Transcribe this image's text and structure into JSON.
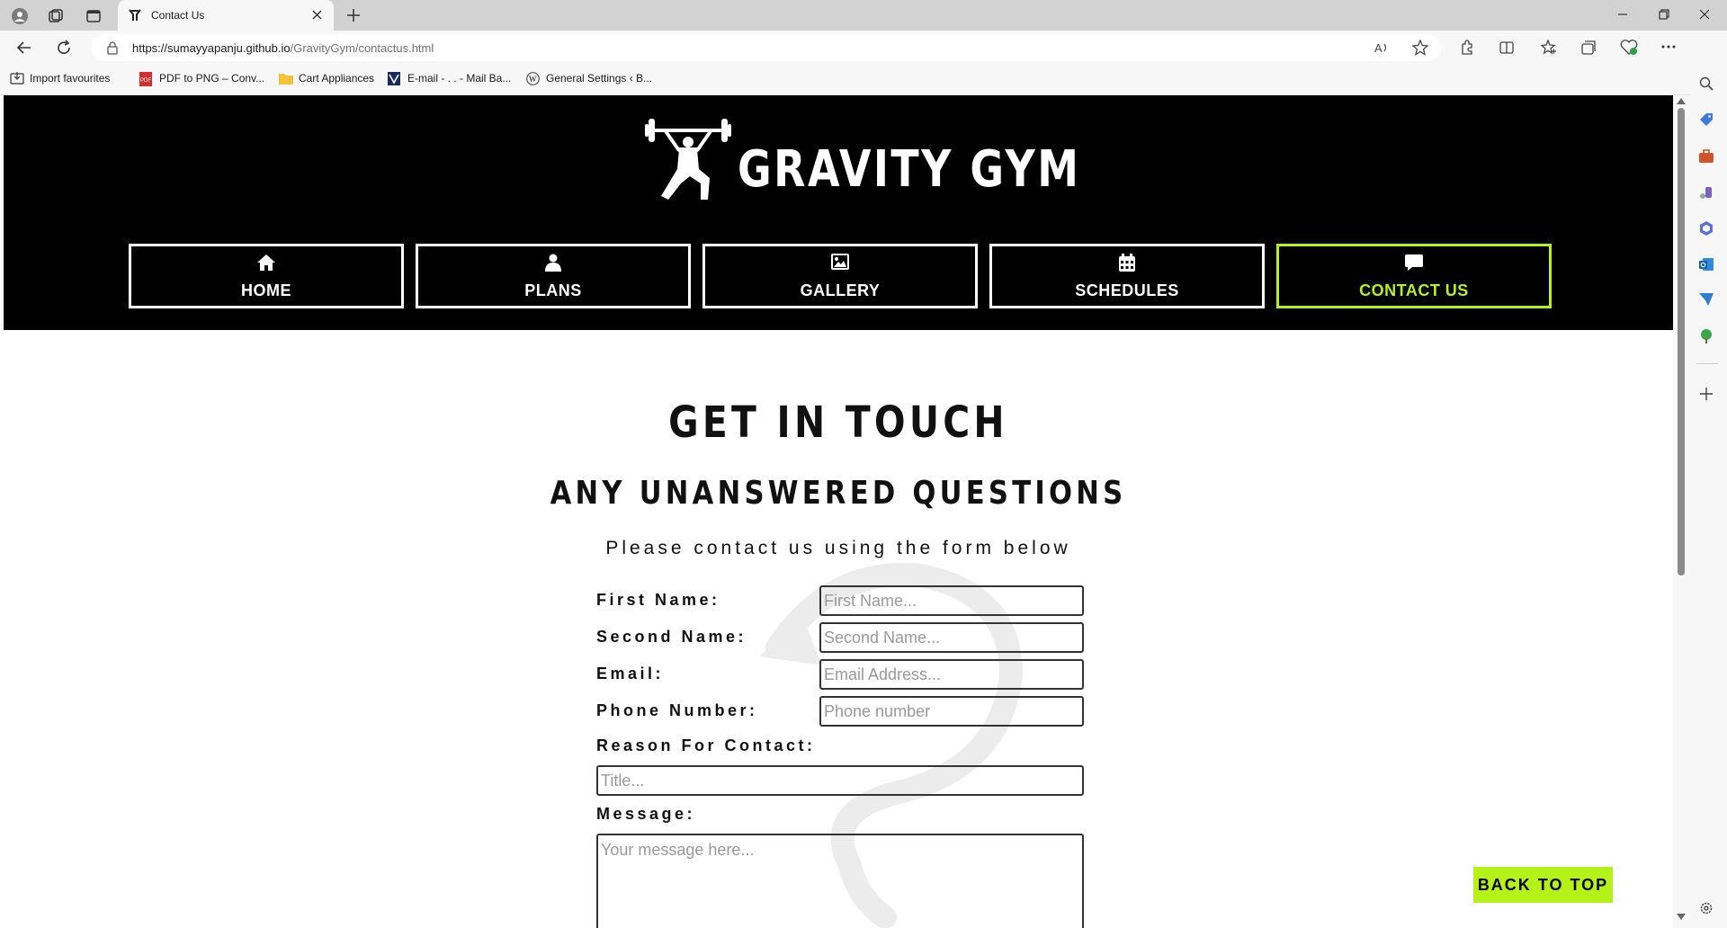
{
  "browser": {
    "tab_title": "Contact Us",
    "url_domain": "https://sumayyapanju.github.io",
    "url_path": "/GravityGym/contactus.html",
    "bookmarks": [
      {
        "label": "Import favourites",
        "icon": "import-icon"
      },
      {
        "label": "PDF to PNG – Conv...",
        "icon": "pdf-icon"
      },
      {
        "label": "Cart Appliances",
        "icon": "folder-icon"
      },
      {
        "label": "E-mail - . . - Mail Ba...",
        "icon": "mail-site-icon"
      },
      {
        "label": "General Settings ‹ B...",
        "icon": "wordpress-icon"
      }
    ]
  },
  "site": {
    "brand": "GRAVITY GYM",
    "nav": [
      {
        "label": "HOME",
        "icon": "home-icon"
      },
      {
        "label": "PLANS",
        "icon": "user-icon"
      },
      {
        "label": "GALLERY",
        "icon": "image-icon"
      },
      {
        "label": "SCHEDULES",
        "icon": "calendar-icon"
      },
      {
        "label": "CONTACT US",
        "icon": "comment-icon",
        "active": true
      }
    ],
    "accent": "#b5f21a"
  },
  "main": {
    "title": "GET IN TOUCH",
    "subtitle": "ANY UNANSWERED QUESTIONS",
    "intro": "Please contact us using the form below"
  },
  "form": {
    "first_name_label": "First Name:",
    "first_name_placeholder": "First Name...",
    "second_name_label": "Second Name:",
    "second_name_placeholder": "Second Name...",
    "email_label": "Email:",
    "email_placeholder": "Email Address...",
    "phone_label": "Phone Number:",
    "phone_placeholder": "Phone number",
    "reason_label": "Reason For Contact:",
    "reason_placeholder": "Title...",
    "message_label": "Message:",
    "message_placeholder": "Your message here..."
  },
  "back_to_top": "BACK TO TOP"
}
